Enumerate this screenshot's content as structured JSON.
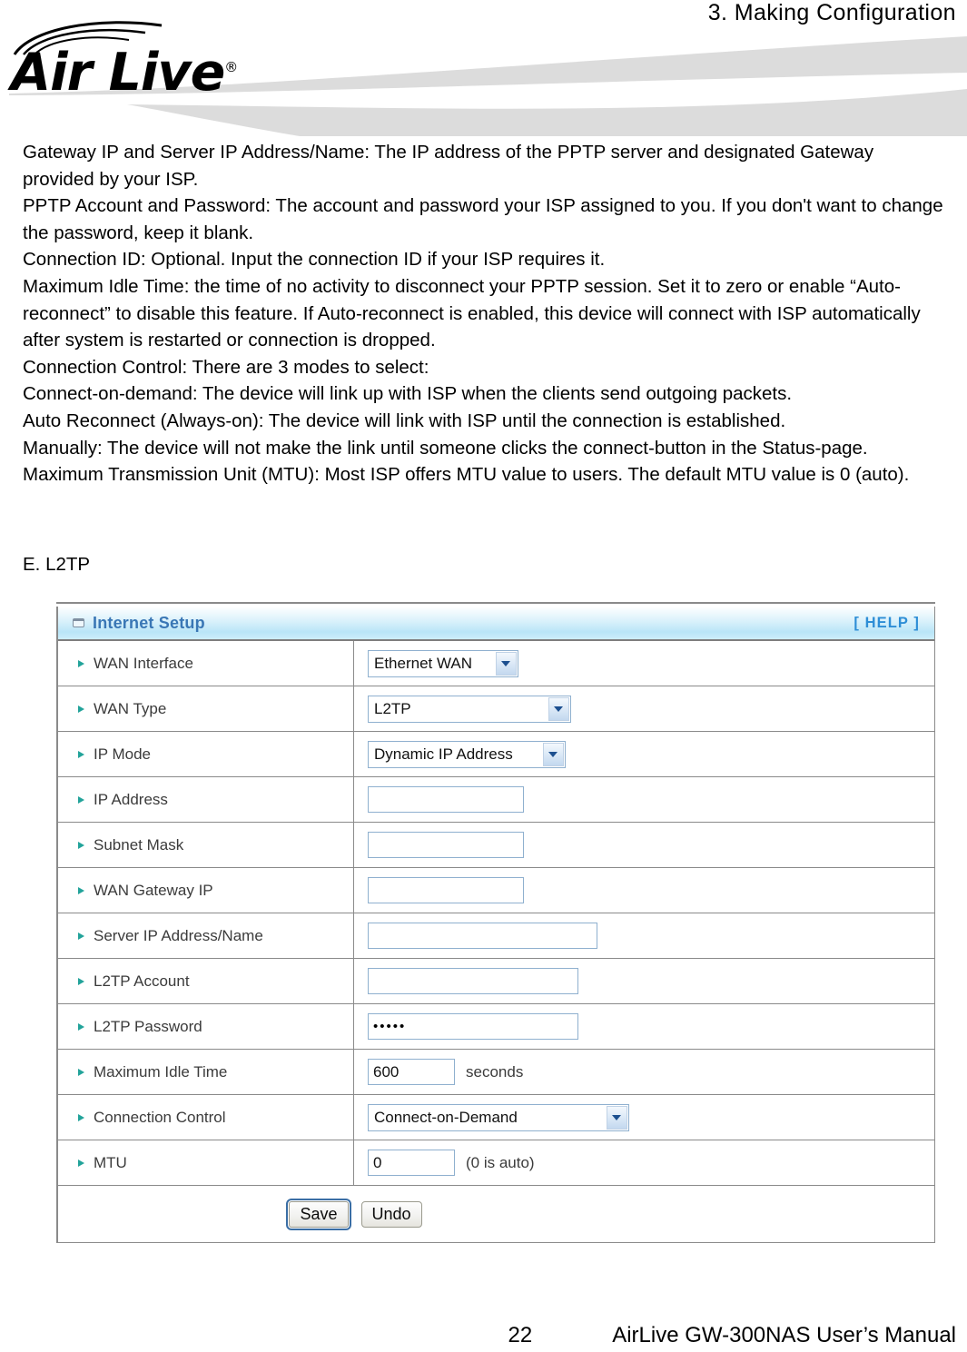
{
  "header": {
    "chapter": "3.  Making  Configuration",
    "logo_text": "Air Live",
    "logo_reg": "®",
    "logo_icon": "wifi-arcs-icon"
  },
  "body": {
    "paragraphs": [
      "Gateway IP and Server IP Address/Name: The IP address of the PPTP server and designated Gateway provided by your ISP.",
      "PPTP Account and Password: The account and password your ISP assigned to you. If you don't want to change the password, keep it blank.",
      "Connection ID: Optional. Input the connection ID if your ISP requires it.",
      "Maximum Idle Time: the time of no activity to disconnect your PPTP session. Set it to zero or enable “Auto-reconnect” to disable this feature. If Auto-reconnect is enabled, this device will connect with ISP automatically after system is restarted or connection is dropped.",
      "Connection Control: There are 3 modes to select:",
      "Connect-on-demand: The device will link up with ISP when the clients send outgoing packets.",
      "Auto Reconnect (Always-on): The device will link with ISP until the connection is established.",
      "Manually: The device will not make the link until someone clicks the connect-button in the Status-page.",
      "Maximum Transmission Unit (MTU): Most ISP offers MTU value to users. The default MTU value is 0 (auto)."
    ],
    "section_label": "E. L2TP"
  },
  "panel": {
    "title": "Internet Setup",
    "help_label": "[ HELP ]",
    "title_icon": "window-icon",
    "accent_color": "#3a77b5",
    "help_color": "#2e8ed6",
    "bullet_color": "#22a39a",
    "rows": [
      {
        "label": "WAN Interface",
        "type": "select",
        "value": "Ethernet WAN"
      },
      {
        "label": "WAN Type",
        "type": "select",
        "value": "L2TP"
      },
      {
        "label": "IP Mode",
        "type": "select",
        "value": "Dynamic IP Address"
      },
      {
        "label": "IP Address",
        "type": "text",
        "value": ""
      },
      {
        "label": "Subnet Mask",
        "type": "text",
        "value": ""
      },
      {
        "label": "WAN Gateway IP",
        "type": "text",
        "value": ""
      },
      {
        "label": "Server IP Address/Name",
        "type": "text",
        "value": ""
      },
      {
        "label": "L2TP Account",
        "type": "text",
        "value": ""
      },
      {
        "label": "L2TP Password",
        "type": "password",
        "value": "•••••"
      },
      {
        "label": "Maximum Idle Time",
        "type": "number",
        "value": "600",
        "hint": "seconds"
      },
      {
        "label": "Connection Control",
        "type": "select",
        "value": "Connect-on-Demand"
      },
      {
        "label": "MTU",
        "type": "number",
        "value": "0",
        "hint": "(0 is auto)"
      }
    ],
    "buttons": {
      "save": "Save",
      "undo": "Undo"
    }
  },
  "footer": {
    "page_number": "22",
    "manual_title": "AirLive GW-300NAS User’s Manual"
  }
}
